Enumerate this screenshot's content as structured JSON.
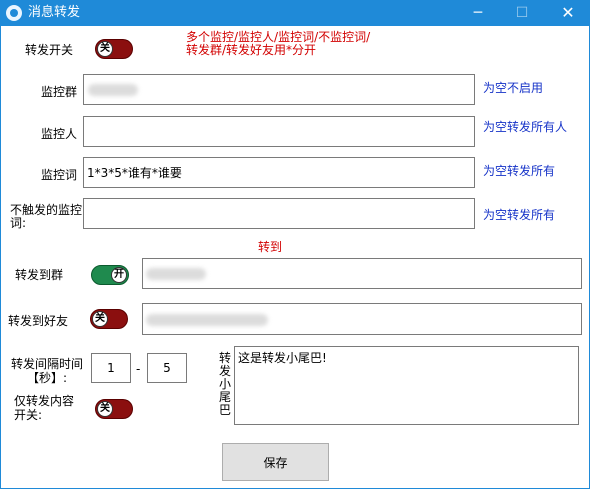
{
  "window": {
    "title": "消息转发",
    "minimize": "─",
    "maximize": "☐",
    "close": "✕"
  },
  "forward_switch": {
    "label": "转发开关",
    "state": "关",
    "note": "多个监控/监控人/监控词/不监控词/转发群/转发好友用*分开"
  },
  "monitor_group": {
    "label": "监控群",
    "value": "",
    "hint": "为空不启用"
  },
  "monitor_person": {
    "label": "监控人",
    "value": "",
    "hint": "为空转发所有人"
  },
  "monitor_word": {
    "label": "监控词",
    "value": "1*3*5*谁有*谁要",
    "hint": "为空转发所有"
  },
  "exclude_word": {
    "label": "不触发的监控词:",
    "value": "",
    "hint": "为空转发所有"
  },
  "forward_to": {
    "heading": "转到"
  },
  "forward_group": {
    "label": "转发到群",
    "state": "开",
    "value": ""
  },
  "forward_friend": {
    "label": "转发到好友",
    "state": "关",
    "value": ""
  },
  "interval": {
    "label": "转发间隔时间【秒】:",
    "min": "1",
    "separator": "-",
    "max": "5"
  },
  "tail": {
    "label": "转发小尾巴",
    "value": "这是转发小尾巴!"
  },
  "content_only": {
    "label": "仅转发内容开关:",
    "state": "关"
  },
  "save": {
    "label": "保存"
  },
  "colors": {
    "titlebar": "#1f8ad8",
    "hint": "#1633c8",
    "note": "#d20000",
    "toggle_on": "#1f8a4e",
    "toggle_off": "#8b0f0f"
  }
}
